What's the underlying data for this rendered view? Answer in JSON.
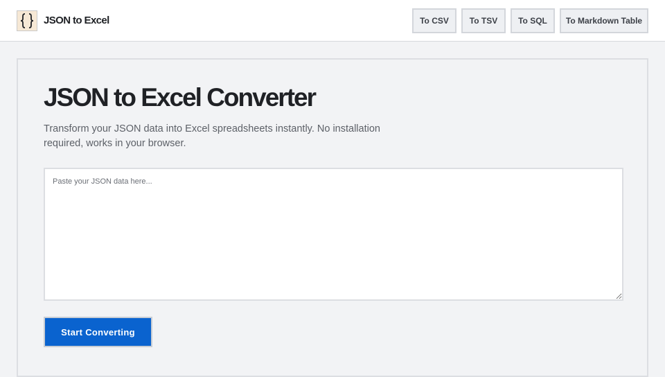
{
  "header": {
    "logo_icon": "curly-braces-icon",
    "brand_name": "JSON to Excel",
    "nav": [
      {
        "label": "To CSV"
      },
      {
        "label": "To TSV"
      },
      {
        "label": "To SQL"
      },
      {
        "label": "To Markdown Table"
      }
    ]
  },
  "main": {
    "title": "JSON to Excel Converter",
    "subtitle": "Transform your JSON data into Excel spreadsheets instantly. No installation required, works in your browser.",
    "input": {
      "value": "",
      "placeholder": "Paste your JSON data here..."
    },
    "start_label": "Start Converting"
  },
  "colors": {
    "accent": "#0a63cf",
    "background": "#f2f3f5",
    "logo_bg": "#f6e8d5"
  }
}
